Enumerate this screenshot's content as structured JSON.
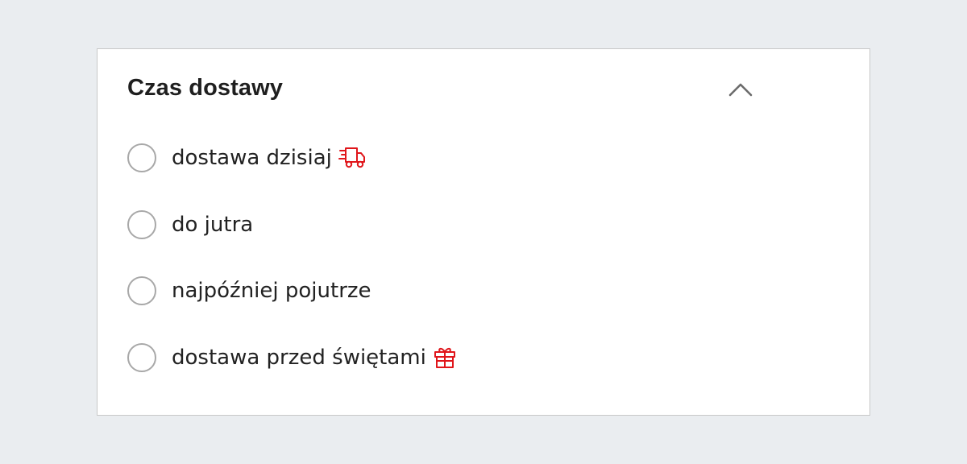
{
  "filter": {
    "title": "Czas dostawy",
    "collapse_icon": "chevron-up-icon",
    "accent_color": "#e0161b",
    "options": [
      {
        "label": "dostawa dzisiaj",
        "icon": "delivery-truck-icon",
        "selected": false
      },
      {
        "label": "do jutra",
        "icon": null,
        "selected": false
      },
      {
        "label": "najpóźniej pojutrze",
        "icon": null,
        "selected": false
      },
      {
        "label": "dostawa przed świętami",
        "icon": "gift-icon",
        "selected": false
      }
    ]
  }
}
